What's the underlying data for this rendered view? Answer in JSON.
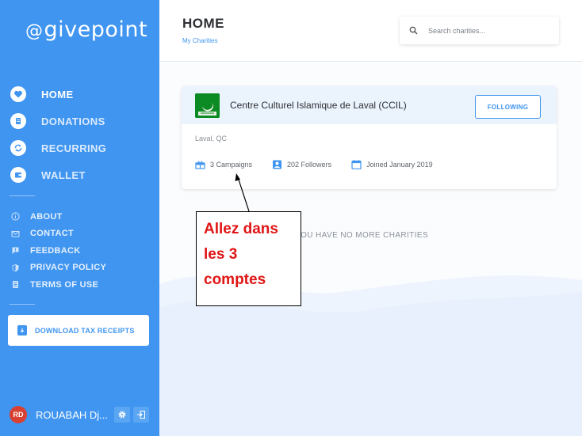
{
  "app": {
    "logo_text": "givepoint",
    "logo_at": "@"
  },
  "sidebar": {
    "main_items": [
      {
        "label": "HOME",
        "icon": "heart-icon",
        "active": true
      },
      {
        "label": "DONATIONS",
        "icon": "list-icon",
        "active": false
      },
      {
        "label": "RECURRING",
        "icon": "refresh-icon",
        "active": false
      },
      {
        "label": "WALLET",
        "icon": "wallet-icon",
        "active": false
      }
    ],
    "sub_items": [
      {
        "label": "ABOUT",
        "icon": "info-icon"
      },
      {
        "label": "CONTACT",
        "icon": "mail-icon"
      },
      {
        "label": "FEEDBACK",
        "icon": "feedback-icon"
      },
      {
        "label": "PRIVACY POLICY",
        "icon": "shield-icon"
      },
      {
        "label": "TERMS OF USE",
        "icon": "document-icon"
      }
    ],
    "tax_button_label": "DOWNLOAD TAX RECEIPTS",
    "user": {
      "initials": "RD",
      "name": "ROUABAH Dj..."
    }
  },
  "header": {
    "title": "HOME",
    "breadcrumb": "My Charities",
    "search_placeholder": "Search charities..."
  },
  "charity": {
    "name": "Centre Culturel Islamique de Laval (CCIL)",
    "follow_label": "FOLLOWING",
    "location": "Laval, QC",
    "campaigns": "3 Campaigns",
    "followers": "202 Followers",
    "joined": "Joined January 2019"
  },
  "empty_message": "YOU HAVE NO MORE CHARITIES",
  "annotation": {
    "lines": [
      "Allez dans",
      "les 3",
      "comptes"
    ]
  },
  "colors": {
    "sidebar": "#3f95f0",
    "accent": "#3f95f0",
    "annotation_text": "#e01515",
    "avatar": "#d94032"
  }
}
